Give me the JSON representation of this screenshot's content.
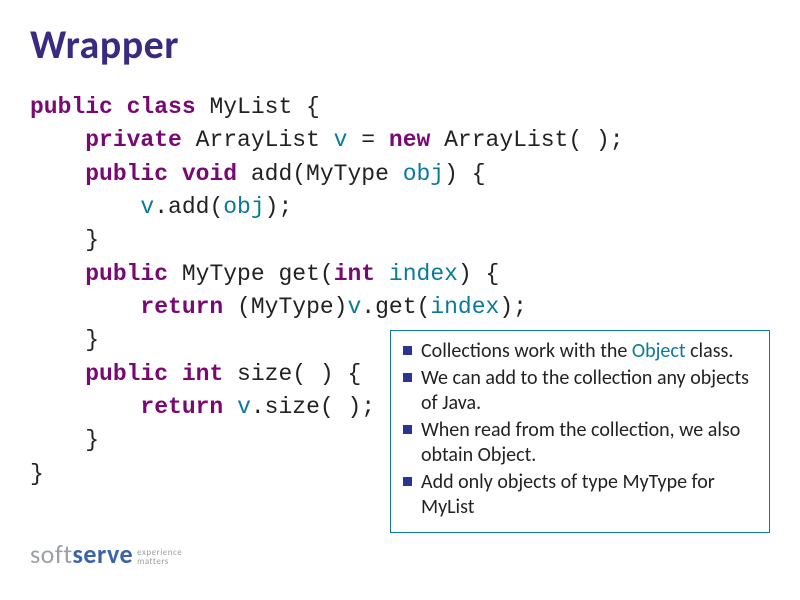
{
  "title": "Wrapper",
  "code": {
    "l1_kw1": "public class",
    "l1_type": " MyList {",
    "l2_indent": "    ",
    "l2_kw1": "private",
    "l2_mid": " ArrayList ",
    "l2_var": "v",
    "l2_eq": " = ",
    "l2_kw2": "new",
    "l2_tail": " ArrayList( );",
    "l3_indent": "    ",
    "l3_kw1": "public void",
    "l3_mid": " add(MyType ",
    "l3_var": "obj",
    "l3_tail": ") {",
    "l4_indent": "        ",
    "l4_var1": "v",
    "l4_mid": ".add(",
    "l4_var2": "obj",
    "l4_tail": ");",
    "l5_indent": "    ",
    "l5_txt": "}",
    "l6_indent": "    ",
    "l6_kw1": "public",
    "l6_mid": " MyType get(",
    "l6_kw2": "int",
    "l6_sp": " ",
    "l6_var": "index",
    "l6_tail": ") {",
    "l7_indent": "        ",
    "l7_kw1": "return",
    "l7_mid": " (MyType)",
    "l7_var1": "v",
    "l7_mid2": ".get(",
    "l7_var2": "index",
    "l7_tail": ");",
    "l8_indent": "    ",
    "l8_txt": "}",
    "l9_indent": "    ",
    "l9_kw1": "public int",
    "l9_tail": " size( ) {",
    "l10_indent": "        ",
    "l10_kw1": "return",
    "l10_sp": " ",
    "l10_var": "v",
    "l10_tail": ".size( );",
    "l11_indent": "    ",
    "l11_txt": "}",
    "l12_txt": "}"
  },
  "bullets": {
    "b1_a": "Collections work with the ",
    "b1_obj": "Object",
    "b1_b": " class.",
    "b2": "We can add to the collection any objects of Java.",
    "b3": "When read from the collection, we also obtain Object.",
    "b4": "Add only objects of type MyType for MyList"
  },
  "logo": {
    "soft": "soft",
    "serve": "serve",
    "tag1": "experience",
    "tag2": "matters"
  }
}
